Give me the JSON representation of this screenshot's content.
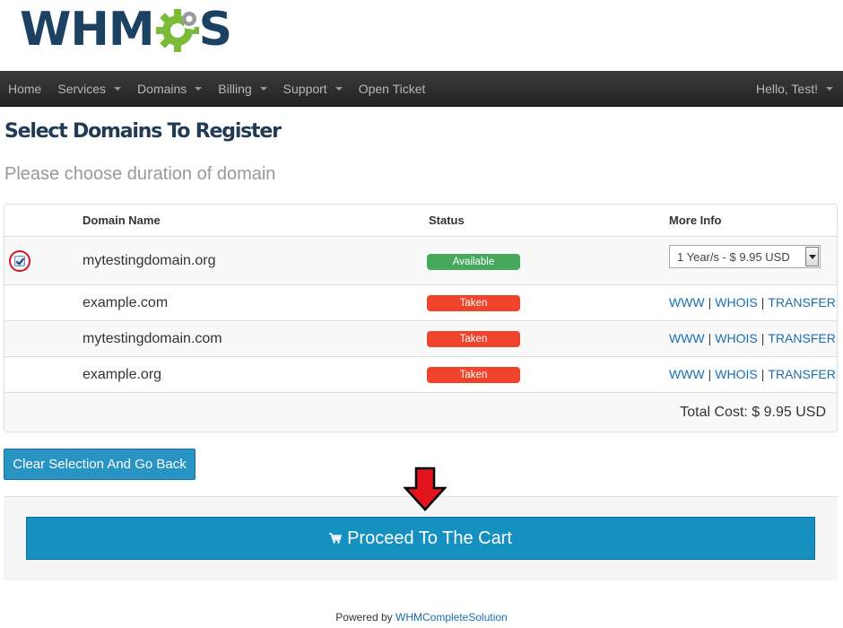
{
  "brand": {
    "logo_prefix": "WHM",
    "logo_suffix": "S",
    "colors": {
      "navy": "#1b4163",
      "green": "#7cba3a"
    }
  },
  "nav": {
    "items": [
      {
        "label": "Home",
        "dropdown": false
      },
      {
        "label": "Services",
        "dropdown": true
      },
      {
        "label": "Domains",
        "dropdown": true
      },
      {
        "label": "Billing",
        "dropdown": true
      },
      {
        "label": "Support",
        "dropdown": true
      },
      {
        "label": "Open Ticket",
        "dropdown": false
      }
    ],
    "user": "Hello, Test!"
  },
  "page": {
    "title": "Select Domains To Register",
    "subtitle": "Please choose duration of domain"
  },
  "table": {
    "headers": {
      "domain": "Domain Name",
      "status": "Status",
      "info": "More Info"
    },
    "rows": [
      {
        "domain": "mytestingdomain.org",
        "status": "Available",
        "checked": true,
        "duration": "1 Year/s - $ 9.95 USD"
      },
      {
        "domain": "example.com",
        "status": "Taken"
      },
      {
        "domain": "mytestingdomain.com",
        "status": "Taken"
      },
      {
        "domain": "example.org",
        "status": "Taken"
      }
    ],
    "link_www": "WWW",
    "link_whois": "WHOIS",
    "link_transfer": "TRANSFER",
    "separator": "|",
    "total": "Total Cost: $ 9.95 USD"
  },
  "buttons": {
    "clear": "Clear Selection And Go Back",
    "proceed": "Proceed To The Cart"
  },
  "footer": {
    "prefix": "Powered by",
    "link": "WHMCompleteSolution"
  },
  "colors": {
    "available": "#45a85c",
    "taken": "#ef432c",
    "primary": "#168fc1"
  }
}
